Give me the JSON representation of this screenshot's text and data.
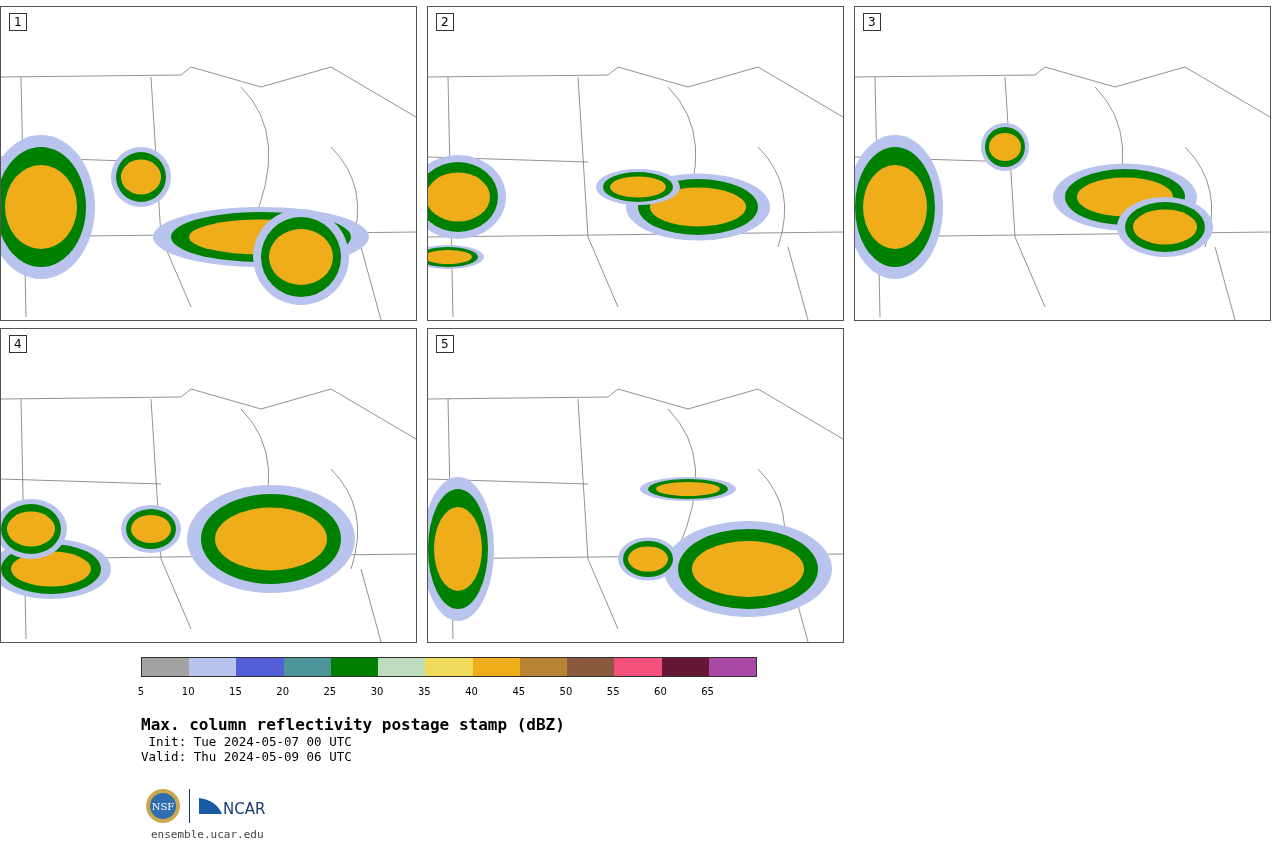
{
  "panels": [
    {
      "label": "1"
    },
    {
      "label": "2"
    },
    {
      "label": "3"
    },
    {
      "label": "4"
    },
    {
      "label": "5"
    }
  ],
  "colorbar": {
    "segments": [
      {
        "color": "#a3a3a3"
      },
      {
        "color": "#b8c3ee"
      },
      {
        "color": "#525fd7"
      },
      {
        "color": "#4f9499"
      },
      {
        "color": "#008000"
      },
      {
        "color": "#bedcbe"
      },
      {
        "color": "#f0da5c"
      },
      {
        "color": "#efad1a"
      },
      {
        "color": "#b88434"
      },
      {
        "color": "#8a5a3e"
      },
      {
        "color": "#f4507c"
      },
      {
        "color": "#651735"
      },
      {
        "color": "#aa48a5"
      }
    ],
    "ticks": [
      "5",
      "10",
      "15",
      "20",
      "25",
      "30",
      "35",
      "40",
      "45",
      "50",
      "55",
      "60",
      "65"
    ]
  },
  "title": "Max. column reflectivity postage stamp (dBZ)",
  "init": " Init: Tue 2024-05-07 00 UTC",
  "valid": "Valid: Thu 2024-05-09 06 UTC",
  "logos": {
    "nsf": "NSF",
    "ncar": "NCAR"
  },
  "site": "ensemble.ucar.edu"
}
